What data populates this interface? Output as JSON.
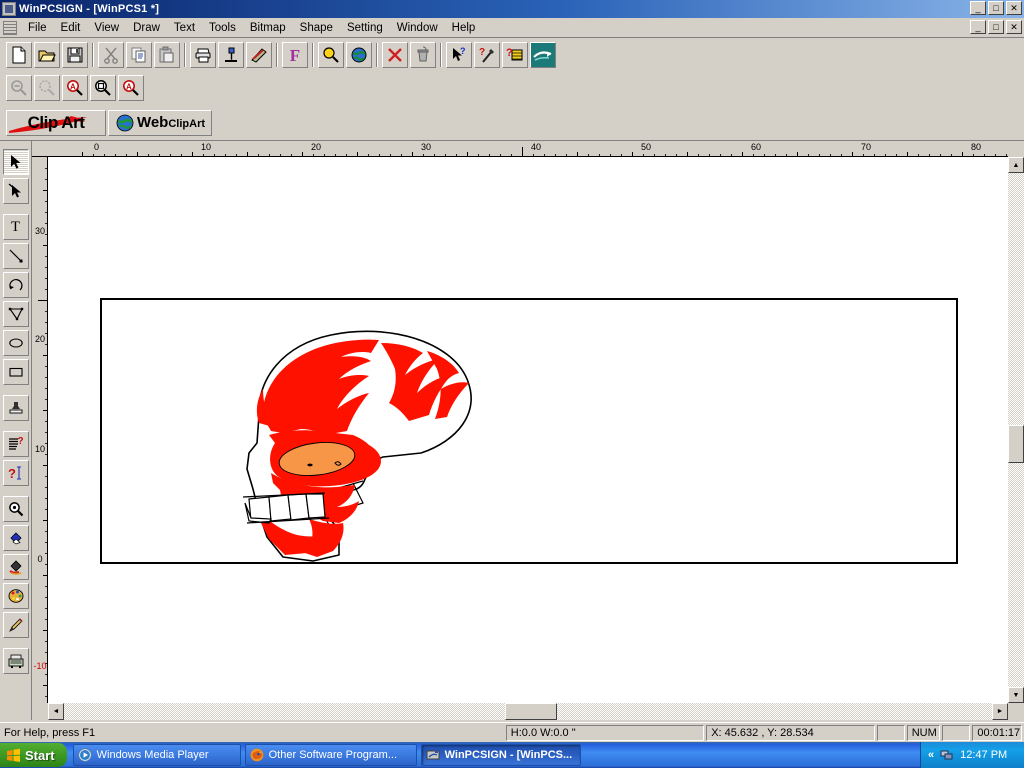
{
  "window": {
    "title": "WinPCSIGN - [WinPCS1 *]",
    "app_icon": "app-icon",
    "minimize": "_",
    "maximize": "□",
    "close": "✕",
    "child_minimize": "_",
    "child_restore": "□",
    "child_close": "✕"
  },
  "menubar": {
    "items": [
      {
        "label": "File"
      },
      {
        "label": "Edit"
      },
      {
        "label": "View"
      },
      {
        "label": "Draw"
      },
      {
        "label": "Text"
      },
      {
        "label": "Tools"
      },
      {
        "label": "Bitmap"
      },
      {
        "label": "Shape"
      },
      {
        "label": "Setting"
      },
      {
        "label": "Window"
      },
      {
        "label": "Help"
      }
    ]
  },
  "toolbar_main": {
    "buttons": [
      {
        "name": "new-file-button",
        "icon": "new-document-icon"
      },
      {
        "name": "open-file-button",
        "icon": "open-folder-icon"
      },
      {
        "name": "save-file-button",
        "icon": "floppy-disk-icon"
      },
      {
        "name": "cut-button",
        "icon": "scissors-icon"
      },
      {
        "name": "copy-button",
        "icon": "copy-icon"
      },
      {
        "name": "paste-button",
        "icon": "clipboard-icon"
      },
      {
        "name": "print-button",
        "icon": "printer-icon"
      },
      {
        "name": "cut-plotter-button",
        "icon": "plotter-icon"
      },
      {
        "name": "weed-button",
        "icon": "weeding-tool-icon"
      },
      {
        "name": "font-button",
        "icon": "font-f-icon"
      },
      {
        "name": "find-button",
        "icon": "magnifier-bulb-icon"
      },
      {
        "name": "web-button",
        "icon": "globe-icon"
      },
      {
        "name": "delete-button",
        "icon": "red-x-icon"
      },
      {
        "name": "trash-button",
        "icon": "trash-icon"
      },
      {
        "name": "context-help-button",
        "icon": "arrow-question-icon"
      },
      {
        "name": "tips-button",
        "icon": "wand-question-icon"
      },
      {
        "name": "help-topics-button",
        "icon": "book-question-icon"
      },
      {
        "name": "send-to-cutter-button",
        "icon": "teal-cutter-icon"
      }
    ]
  },
  "toolbar_zoom": {
    "buttons": [
      {
        "name": "zoom-out-button",
        "icon": "zoom-out-icon"
      },
      {
        "name": "zoom-previous-button",
        "icon": "zoom-previous-icon"
      },
      {
        "name": "zoom-all-button",
        "icon": "zoom-all-icon",
        "badge": "A"
      },
      {
        "name": "zoom-page-button",
        "icon": "zoom-page-icon"
      },
      {
        "name": "zoom-selection-button",
        "icon": "zoom-selection-icon",
        "badge": "A"
      }
    ]
  },
  "toolbar_clipart": {
    "clipart_label": "Clip Art",
    "web_label_top": "Web",
    "web_label_bottom": "ClipArt"
  },
  "tool_palette": {
    "tools": [
      {
        "name": "select-tool",
        "icon": "arrow-pointer-icon",
        "selected": true
      },
      {
        "name": "node-edit-tool",
        "icon": "node-edit-icon",
        "selected": false
      },
      {
        "name": "text-tool",
        "icon": "text-t-icon",
        "selected": false
      },
      {
        "name": "line-tool",
        "icon": "line-icon",
        "selected": false
      },
      {
        "name": "arc-tool",
        "icon": "arc-icon",
        "selected": false
      },
      {
        "name": "polygon-tool",
        "icon": "polygon-icon",
        "selected": false
      },
      {
        "name": "ellipse-tool",
        "icon": "ellipse-icon",
        "selected": false
      },
      {
        "name": "rectangle-tool",
        "icon": "rectangle-icon",
        "selected": false
      },
      {
        "name": "stamp-tool",
        "icon": "stamp-icon",
        "selected": false
      },
      {
        "name": "text-block-tool",
        "icon": "text-block-question-icon",
        "selected": false
      },
      {
        "name": "text-cursor-tool",
        "icon": "text-cursor-question-icon",
        "selected": false
      },
      {
        "name": "zoom-tool",
        "icon": "magnifier-icon",
        "selected": false
      },
      {
        "name": "fill-color-tool",
        "icon": "blue-diamond-icon",
        "selected": false
      },
      {
        "name": "paint-bucket-tool",
        "icon": "paint-bucket-icon",
        "selected": false
      },
      {
        "name": "palette-tool",
        "icon": "color-palette-icon",
        "selected": false
      },
      {
        "name": "pencil-tool",
        "icon": "pencil-icon",
        "selected": false
      },
      {
        "name": "cutter-tool",
        "icon": "cutter-machine-icon",
        "selected": false
      }
    ]
  },
  "rulers": {
    "horizontal": {
      "labels": [
        "0",
        "10",
        "20",
        "30",
        "40",
        "50",
        "60",
        "70",
        "80"
      ],
      "positions": [
        98,
        208,
        318,
        428,
        538,
        648,
        758,
        868,
        978
      ]
    },
    "vertical": {
      "labels": [
        "30",
        "20",
        "10",
        "0",
        "-10"
      ],
      "positions": [
        232,
        338,
        448,
        555,
        668
      ]
    }
  },
  "artwork": {
    "name": "flaming-skull-clipart",
    "colors": {
      "flame": "#ff1100",
      "eye": "#f79646",
      "outline": "#000000"
    }
  },
  "statusbar": {
    "help_text": "For Help, press F1",
    "dimensions": "H:0.0  W:0.0 \"",
    "coordinates": "X: 45.632 , Y: 28.534",
    "blank1": "",
    "num_lock": "NUM",
    "blank2": "",
    "elapsed": "00:01:17"
  },
  "taskbar": {
    "start_label": "Start",
    "tasks": [
      {
        "label": "Windows Media Player",
        "icon": "media-player-icon",
        "active": false
      },
      {
        "label": "Other Software Program...",
        "icon": "firefox-icon",
        "active": false
      },
      {
        "label": "WinPCSIGN - [WinPCS...",
        "icon": "app-icon",
        "active": true
      }
    ],
    "tray": {
      "chevron": "«",
      "icon": "network-icon",
      "clock": "12:47 PM"
    }
  },
  "scrollbars": {
    "v_up": "▲",
    "v_down": "▼",
    "h_left": "◄",
    "h_right": "►"
  }
}
